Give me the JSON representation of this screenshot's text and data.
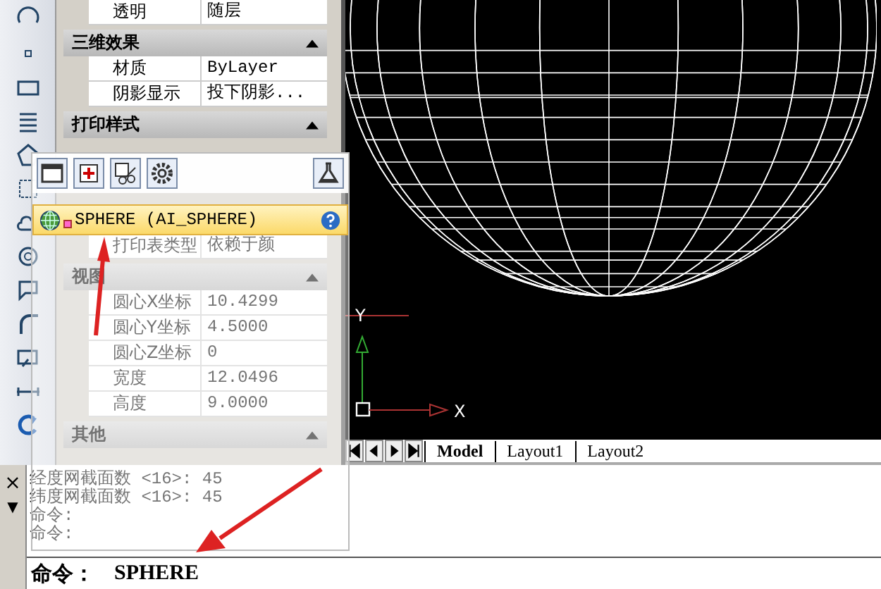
{
  "properties_palette": {
    "sections": [
      {
        "rows": [
          {
            "name": "透明",
            "value": "随层"
          }
        ]
      },
      {
        "title": "三维效果",
        "expanded": true,
        "rows": [
          {
            "name": "材质",
            "value": "ByLayer"
          },
          {
            "name": "阴影显示",
            "value": "投下阴影..."
          }
        ]
      },
      {
        "title": "打印样式",
        "expanded": true,
        "rows": [
          {
            "name": "打印表类型",
            "value": "依赖于颜"
          }
        ]
      },
      {
        "title": "视图",
        "expanded": true,
        "rows": [
          {
            "name": "圆心X坐标",
            "value": "10.4299"
          },
          {
            "name": "圆心Y坐标",
            "value": "4.5000"
          },
          {
            "name": "圆心Z坐标",
            "value": "0"
          },
          {
            "name": "宽度",
            "value": "12.0496"
          },
          {
            "name": "高度",
            "value": "9.0000"
          }
        ]
      },
      {
        "title": "其他",
        "expanded": true
      }
    ]
  },
  "autocomplete_popup": {
    "items": [
      {
        "label": "SPHERE (AI_SPHERE)",
        "selected": true
      }
    ]
  },
  "canvas": {
    "ucs": {
      "x_label": "X",
      "y_label": "Y"
    }
  },
  "layout_tabs": [
    {
      "label": "Model",
      "selected": true
    },
    {
      "label": "Layout1",
      "selected": false
    },
    {
      "label": "Layout2",
      "selected": false
    }
  ],
  "command_window": {
    "close_glyph": "×",
    "menu_glyph": "▼",
    "history": [
      "经度网截面数 <16>: 45",
      "纬度网截面数 <16>: 45",
      "命令:",
      "命令:"
    ],
    "prompt": "命令：",
    "input": "SPHERE"
  }
}
